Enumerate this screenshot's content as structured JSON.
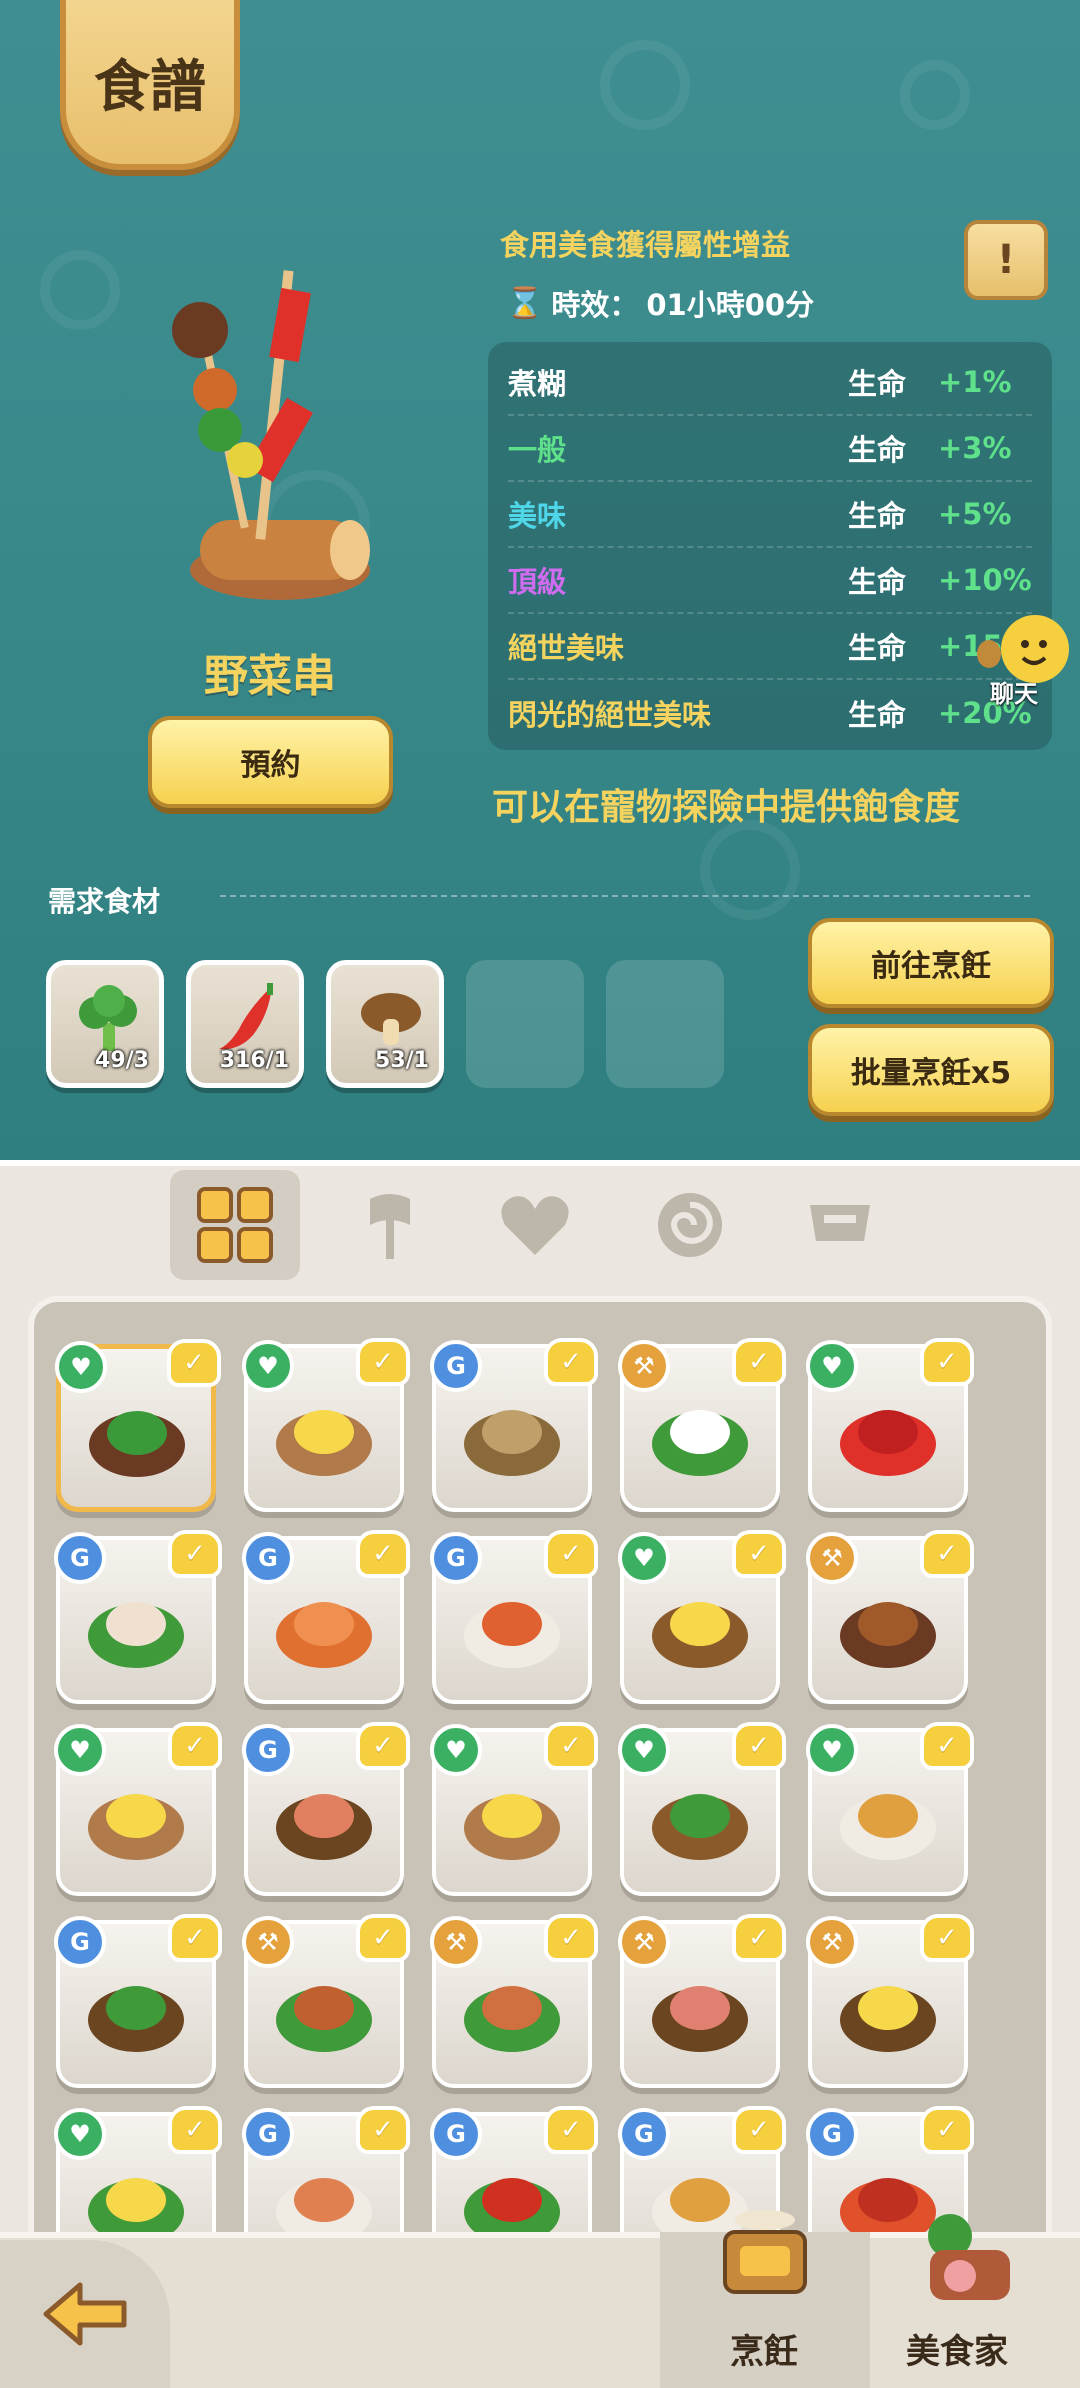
{
  "header": {
    "title": "食譜"
  },
  "dish": {
    "name": "野菜串",
    "reserve_label": "預約"
  },
  "bonus": {
    "title": "食用美食獲得屬性增益",
    "duration_label": "時效：",
    "duration_value": "01小時00分",
    "info_icon": "exclamation-scroll-icon",
    "rows": [
      {
        "quality": "煮糊",
        "stat": "生命",
        "value": "+1%",
        "color": "#ffffff"
      },
      {
        "quality": "一般",
        "stat": "生命",
        "value": "+3%",
        "color": "#5fe08a"
      },
      {
        "quality": "美味",
        "stat": "生命",
        "value": "+5%",
        "color": "#4fd6e8"
      },
      {
        "quality": "頂級",
        "stat": "生命",
        "value": "+10%",
        "color": "#d06cf0"
      },
      {
        "quality": "絕世美味",
        "stat": "生命",
        "value": "+15%",
        "color": "#f4d35e"
      },
      {
        "quality": "閃光的絕世美味",
        "stat": "生命",
        "value": "+20%",
        "color": "#f4d35e"
      }
    ],
    "pet_hint": "可以在寵物探險中提供飽食度"
  },
  "chat": {
    "label": "聊天"
  },
  "ingredients": {
    "label": "需求食材",
    "items": [
      {
        "name": "broccoli",
        "count": "49/3"
      },
      {
        "name": "chili-pepper",
        "count": "316/1"
      },
      {
        "name": "mushroom",
        "count": "53/1"
      }
    ],
    "empty_slots": 2
  },
  "actions": {
    "go_cook": "前往烹飪",
    "batch_cook": "批量烹飪x5"
  },
  "tabs": [
    {
      "icon": "grid-icon",
      "active": true
    },
    {
      "icon": "axe-icon",
      "active": false
    },
    {
      "icon": "heart-icon",
      "active": false
    },
    {
      "icon": "spiral-icon",
      "active": false
    },
    {
      "icon": "helmet-icon",
      "active": false
    }
  ],
  "recipes": [
    {
      "type": "heart",
      "dish": "skewer",
      "selected": true
    },
    {
      "type": "heart",
      "dish": "custard-bowl"
    },
    {
      "type": "spiral",
      "dish": "fish-skewer"
    },
    {
      "type": "axe",
      "dish": "fried-eggs"
    },
    {
      "type": "heart",
      "dish": "chili-peppers"
    },
    {
      "type": "spiral",
      "dish": "scallops"
    },
    {
      "type": "spiral",
      "dish": "shrimp-skewer"
    },
    {
      "type": "spiral",
      "dish": "seafood-soup"
    },
    {
      "type": "heart",
      "dish": "veggie-plate"
    },
    {
      "type": "axe",
      "dish": "mushroom-skewer"
    },
    {
      "type": "heart",
      "dish": "custard-bowl"
    },
    {
      "type": "spiral",
      "dish": "seafood-platter"
    },
    {
      "type": "heart",
      "dish": "custard-bowl"
    },
    {
      "type": "heart",
      "dish": "broccoli-plate"
    },
    {
      "type": "heart",
      "dish": "veggie-stew"
    },
    {
      "type": "spiral",
      "dish": "fish-leaf"
    },
    {
      "type": "axe",
      "dish": "roast-meat"
    },
    {
      "type": "axe",
      "dish": "grilled-steak"
    },
    {
      "type": "axe",
      "dish": "ham"
    },
    {
      "type": "axe",
      "dish": "egg-plate"
    },
    {
      "type": "heart",
      "dish": "corn-plate"
    },
    {
      "type": "spiral",
      "dish": "noodle-bowl"
    },
    {
      "type": "spiral",
      "dish": "crab-plate"
    },
    {
      "type": "spiral",
      "dish": "soup-bowl"
    },
    {
      "type": "spiral",
      "dish": "lobster"
    }
  ],
  "bottom_nav": {
    "back_icon": "back-arrow-icon",
    "cook_label": "烹飪",
    "gourmet_label": "美食家"
  }
}
